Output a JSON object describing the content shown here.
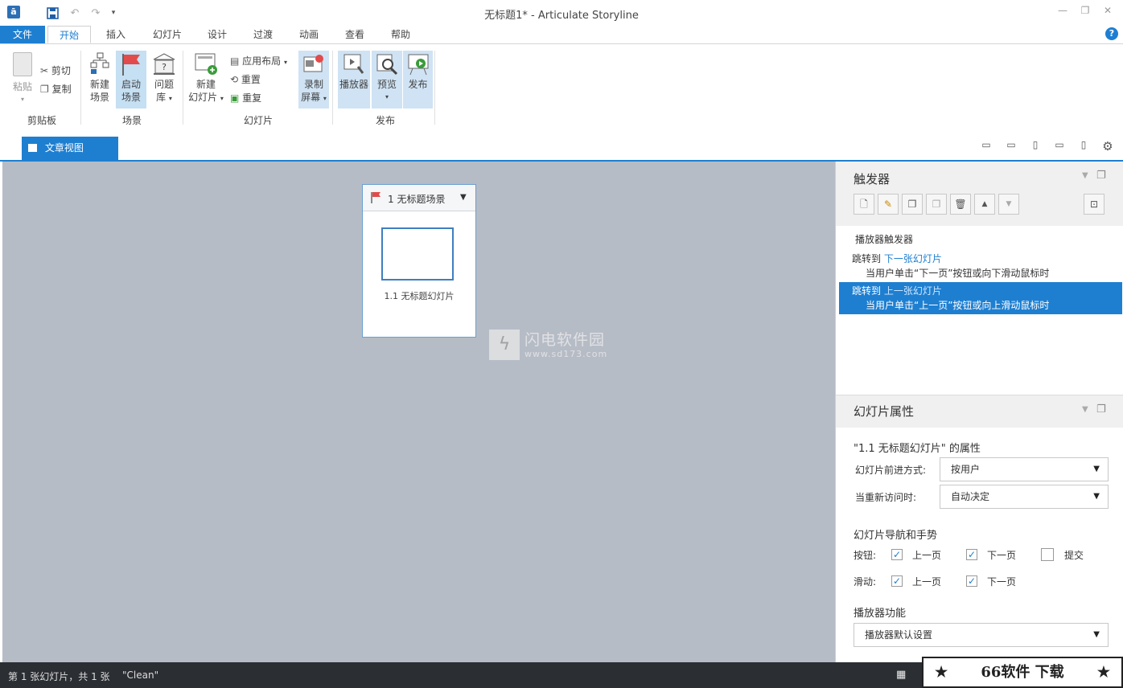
{
  "window": {
    "title": "无标题1* -  Articulate Storyline"
  },
  "menu": {
    "tabs": [
      {
        "label": "文件"
      },
      {
        "label": "开始"
      },
      {
        "label": "插入"
      },
      {
        "label": "幻灯片"
      },
      {
        "label": "设计"
      },
      {
        "label": "过渡"
      },
      {
        "label": "动画"
      },
      {
        "label": "查看"
      },
      {
        "label": "帮助"
      }
    ],
    "help": "?"
  },
  "ribbon": {
    "clipboard": {
      "paste": "粘贴",
      "cut": "剪切",
      "copy": "复制",
      "label": "剪贴板"
    },
    "scene": {
      "new_line1": "新建",
      "new_line2": "场景",
      "start_line1": "启动",
      "start_line2": "场景",
      "bank_line1": "问题",
      "bank_line2": "库",
      "label": "场景"
    },
    "slides": {
      "new_line1": "新建",
      "new_line2": "幻灯片",
      "layout": "应用布局",
      "reset": "重置",
      "duplicate": "重复",
      "label": "幻灯片"
    },
    "record": {
      "line1": "录制",
      "line2": "屏幕"
    },
    "publish": {
      "player": "播放器",
      "preview": "预览",
      "publish": "发布",
      "label": "发布"
    }
  },
  "viewbar": {
    "story_view": "文章视图"
  },
  "scene_card": {
    "title": "1 无标题场景",
    "slide_label": "1.1 无标题幻灯片"
  },
  "watermark": {
    "brand": "闪电软件园",
    "url": "www.sd173.com"
  },
  "triggers": {
    "title": "触发器",
    "section": "播放器触发器",
    "items": [
      {
        "action": "跳转到",
        "target": "下一张幻灯片",
        "condition": "当用户单击“下一页”按钮或向下滑动鼠标时"
      },
      {
        "action": "跳转到",
        "target": "上一张幻灯片",
        "condition": "当用户单击“上一页”按钮或向上滑动鼠标时"
      }
    ]
  },
  "slide_props": {
    "title": "幻灯片属性",
    "heading": "\"1.1 无标题幻灯片\" 的属性",
    "advance_label": "幻灯片前进方式:",
    "advance_value": "按用户",
    "revisit_label": "当重新访问时:",
    "revisit_value": "自动决定",
    "nav_heading": "幻灯片导航和手势",
    "buttons_label": "按钮:",
    "swipe_label": "滑动:",
    "prev": "上一页",
    "next": "下一页",
    "submit": "提交",
    "player_heading": "播放器功能",
    "player_value": "播放器默认设置"
  },
  "status": {
    "text": "第 1 张幻灯片，共 1 张",
    "theme": "\"Clean\""
  },
  "badge": {
    "text": "66软件 下载"
  },
  "colors": {
    "accent": "#1e7fd1",
    "canvas": "#b6bcc6",
    "selected_row": "#1e7fd1",
    "status_bg": "#2b2e33"
  }
}
